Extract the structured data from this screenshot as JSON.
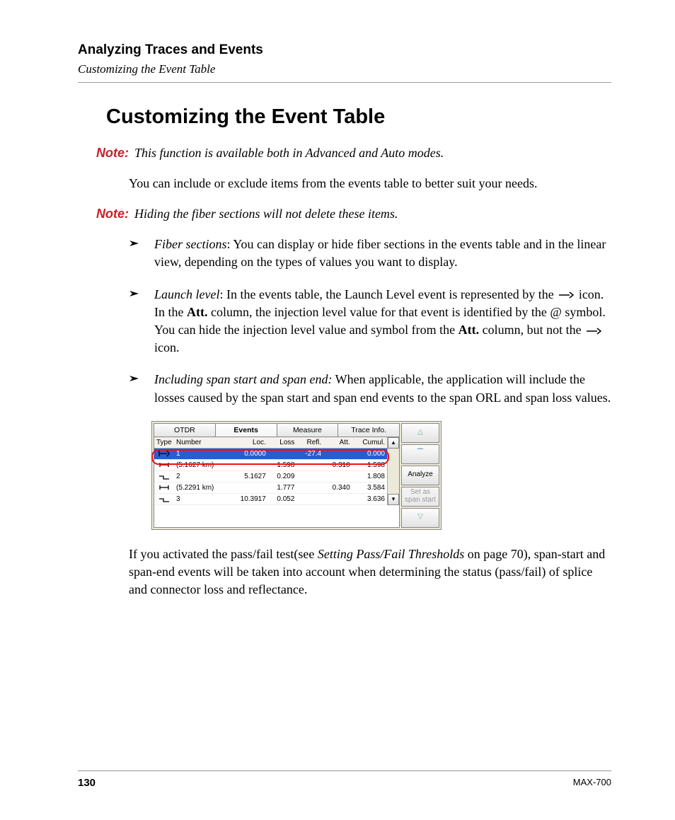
{
  "header": {
    "chapter": "Analyzing Traces and Events",
    "section": "Customizing the Event Table"
  },
  "title": "Customizing the Event Table",
  "notes": {
    "label": "Note:",
    "note1": "This function is available both in Advanced and Auto modes.",
    "note2": "Hiding the fiber sections will not delete these items."
  },
  "para1": "You can include or exclude items from the events table to better suit your needs.",
  "bullets": {
    "b1_lead": "Fiber sections",
    "b1_rest": ": You can display or hide fiber sections in the events table and in the linear view, depending on the types of values you want to display.",
    "b2_lead": "Launch level",
    "b2_part1": ": In the events table, the Launch Level event is represented by the ",
    "b2_part2": " icon. In the ",
    "b2_att": "Att.",
    "b2_part3": " column, the injection level value for that event is identified by the @ symbol.",
    "b2_part4": "You can hide the injection level value and symbol from the ",
    "b2_part5": " column, but not the ",
    "b2_part6": " icon.",
    "b3_lead": "Including span start and span end:",
    "b3_rest": " When applicable, the application will include the losses caused by the span start and span end events to the span ORL and span loss values."
  },
  "para2_a": "If you activated the pass/fail test(see ",
  "para2_em": "Setting Pass/Fail Thresholds",
  "para2_b": " on page 70), span-start and span-end events will be taken into account when determining the status (pass/fail) of splice and connector loss and reflectance.",
  "figure": {
    "tabs": [
      "OTDR",
      "Events",
      "Measure",
      "Trace Info."
    ],
    "active_tab_index": 1,
    "columns": [
      "Type",
      "Number",
      "Loc.",
      "Loss",
      "Refl.",
      "Att.",
      "Cumul."
    ],
    "rows": [
      {
        "icon": "launch",
        "num": "1",
        "loc": "0.0000",
        "loss": "",
        "refl": "-27.4",
        "att": "",
        "cumul": "0.000",
        "selected": true
      },
      {
        "icon": "section",
        "num": "(5.1627 km)",
        "loc": "",
        "loss": "1.598",
        "refl": "",
        "att": "0.310",
        "cumul": "1.598"
      },
      {
        "icon": "splice",
        "num": "2",
        "loc": "5.1627",
        "loss": "0.209",
        "refl": "",
        "att": "",
        "cumul": "1.808"
      },
      {
        "icon": "section",
        "num": "(5.2291 km)",
        "loc": "",
        "loss": "1.777",
        "refl": "",
        "att": "0.340",
        "cumul": "3.584"
      },
      {
        "icon": "splice",
        "num": "3",
        "loc": "10.3917",
        "loss": "0.052",
        "refl": "",
        "att": "",
        "cumul": "3.636"
      }
    ],
    "side_buttons": {
      "up": "△",
      "zoom": "⁀",
      "analyze": "Analyze",
      "span": "Set as span start",
      "down": "▽"
    }
  },
  "footer": {
    "page": "130",
    "model": "MAX-700"
  }
}
